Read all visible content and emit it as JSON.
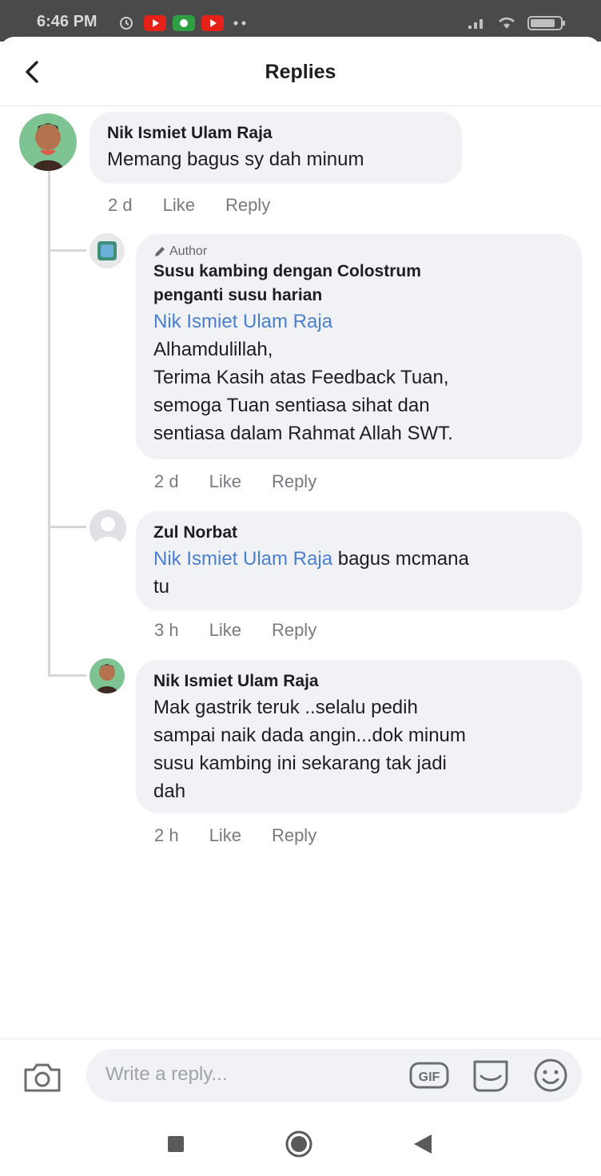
{
  "status_bar": {
    "time": "6:46 PM"
  },
  "header": {
    "title": "Replies"
  },
  "comments": [
    {
      "name": "Nik Ismiet Ulam Raja",
      "text": "Memang bagus sy dah minum",
      "time": "2 d",
      "like": "Like",
      "reply": "Reply"
    },
    {
      "badge": "Author",
      "name_line1": "Susu kambing dengan Colostrum",
      "name_line2": "penganti susu harian",
      "mention": "Nik Ismiet Ulam Raja",
      "lines": [
        "Alhamdulillah,",
        "Terima Kasih atas Feedback Tuan,",
        "semoga Tuan sentiasa sihat dan",
        "sentiasa dalam Rahmat Allah SWT."
      ],
      "time": "2 d",
      "like": "Like",
      "reply": "Reply"
    },
    {
      "name": "Zul Norbat",
      "mention": "Nik Ismiet Ulam Raja",
      "text_after": "bagus mcmana",
      "line2": "tu",
      "time": "3 h",
      "like": "Like",
      "reply": "Reply"
    },
    {
      "name": "Nik Ismiet Ulam Raja",
      "lines": [
        "Mak gastrik teruk ..selalu pedih",
        "sampai naik dada angin...dok minum",
        "susu kambing ini sekarang tak jadi",
        "dah"
      ],
      "time": "2 h",
      "like": "Like",
      "reply": "Reply"
    }
  ],
  "composer": {
    "placeholder": "Write a reply...",
    "gif_label": "GIF"
  }
}
